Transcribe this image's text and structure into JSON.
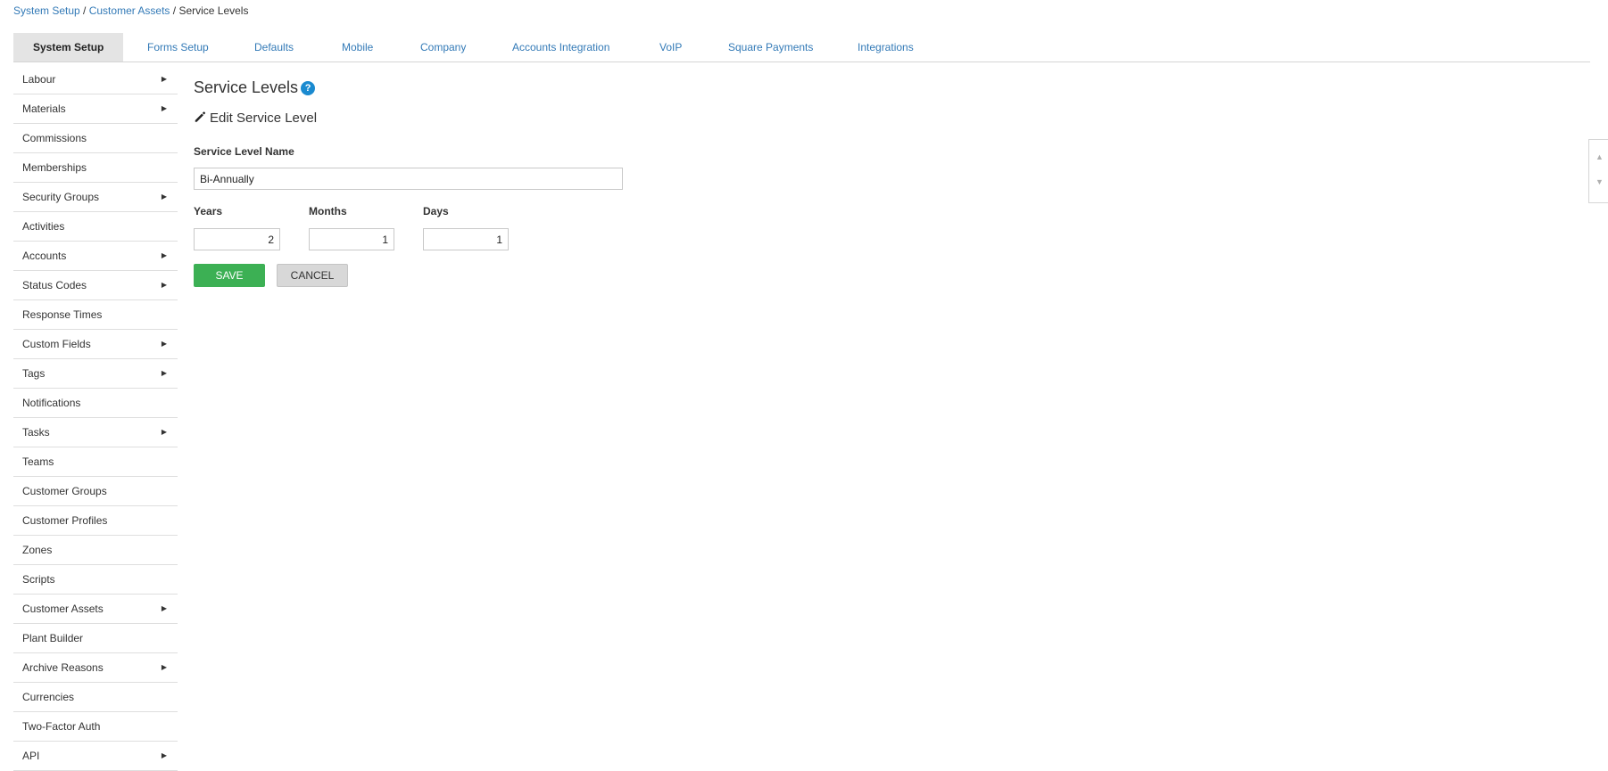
{
  "breadcrumb": {
    "items": [
      "System Setup",
      "Customer Assets"
    ],
    "separator": " / ",
    "current": "Service Levels"
  },
  "tabs": [
    {
      "label": "System Setup",
      "active": true
    },
    {
      "label": "Forms Setup"
    },
    {
      "label": "Defaults"
    },
    {
      "label": "Mobile"
    },
    {
      "label": "Company"
    },
    {
      "label": "Accounts Integration"
    },
    {
      "label": "VoIP"
    },
    {
      "label": "Square Payments"
    },
    {
      "label": "Integrations"
    }
  ],
  "sidebar": {
    "items": [
      {
        "label": "Labour",
        "arrow": true
      },
      {
        "label": "Materials",
        "arrow": true
      },
      {
        "label": "Commissions",
        "arrow": false
      },
      {
        "label": "Memberships",
        "arrow": false
      },
      {
        "label": "Security Groups",
        "arrow": true
      },
      {
        "label": "Activities",
        "arrow": false
      },
      {
        "label": "Accounts",
        "arrow": true
      },
      {
        "label": "Status Codes",
        "arrow": true
      },
      {
        "label": "Response Times",
        "arrow": false
      },
      {
        "label": "Custom Fields",
        "arrow": true
      },
      {
        "label": "Tags",
        "arrow": true
      },
      {
        "label": "Notifications",
        "arrow": false
      },
      {
        "label": "Tasks",
        "arrow": true
      },
      {
        "label": "Teams",
        "arrow": false
      },
      {
        "label": "Customer Groups",
        "arrow": false
      },
      {
        "label": "Customer Profiles",
        "arrow": false
      },
      {
        "label": "Zones",
        "arrow": false
      },
      {
        "label": "Scripts",
        "arrow": false
      },
      {
        "label": "Customer Assets",
        "arrow": true
      },
      {
        "label": "Plant Builder",
        "arrow": false
      },
      {
        "label": "Archive Reasons",
        "arrow": true
      },
      {
        "label": "Currencies",
        "arrow": false
      },
      {
        "label": "Two-Factor Auth",
        "arrow": false
      },
      {
        "label": "API",
        "arrow": true
      }
    ],
    "arrow_glyph": "▶"
  },
  "main": {
    "title": "Service Levels",
    "help_glyph": "?",
    "subtitle": "Edit Service Level",
    "form": {
      "name_label": "Service Level Name",
      "name_value": "Bi-Annually",
      "years_label": "Years",
      "years_value": "2",
      "months_label": "Months",
      "months_value": "1",
      "days_label": "Days",
      "days_value": "1"
    },
    "save_label": "SAVE",
    "cancel_label": "CANCEL"
  },
  "scroll_widget": {
    "up_glyph": "▲",
    "down_glyph": "▼"
  },
  "colors": {
    "link": "#337ab7",
    "save": "#3cb054",
    "help": "#1a8ad0"
  }
}
